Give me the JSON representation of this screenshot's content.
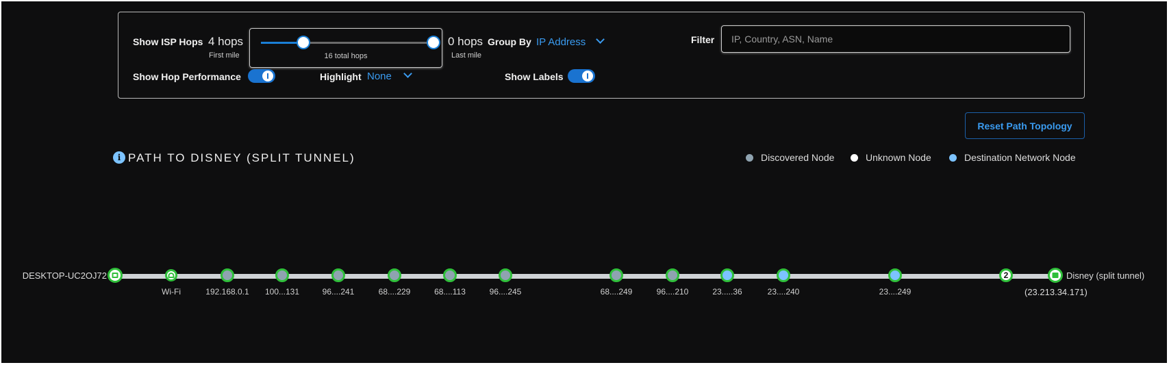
{
  "controls": {
    "show_isp_hops_label": "Show ISP Hops",
    "first_mile_hops": "4 hops",
    "first_mile_label": "First mile",
    "total_hops": "16 total hops",
    "last_mile_hops": "0 hops",
    "last_mile_label": "Last mile",
    "slider": {
      "min": 0,
      "max": 16,
      "first_mile": 4,
      "last_mile": 0
    },
    "group_by_label": "Group By",
    "group_by_value": "IP Address",
    "filter_label": "Filter",
    "filter_placeholder": "IP, Country, ASN, Name",
    "filter_value": "",
    "show_hop_performance_label": "Show Hop Performance",
    "show_hop_performance": true,
    "highlight_label": "Highlight",
    "highlight_value": "None",
    "show_labels_label": "Show Labels",
    "show_labels": true
  },
  "reset_button": "Reset Path Topology",
  "title": "PATH TO DISNEY (SPLIT TUNNEL)",
  "legend": [
    {
      "label": "Discovered Node",
      "color": "#8fa3b0"
    },
    {
      "label": "Unknown Node",
      "color": "#ffffff"
    },
    {
      "label": "Destination Network Node",
      "color": "#7cc3ff"
    }
  ],
  "path": {
    "source": "DESKTOP-UC2OJ72",
    "destination": "Disney (split tunnel)",
    "destination_ip": "(23.213.34.171)",
    "nodes": [
      {
        "type": "source",
        "label": ""
      },
      {
        "type": "wifi",
        "label": "Wi-Fi"
      },
      {
        "type": "discovered",
        "label": "192.168.0.1"
      },
      {
        "type": "discovered",
        "label": "100...131"
      },
      {
        "type": "discovered",
        "label": "96....241"
      },
      {
        "type": "discovered",
        "label": "68....229"
      },
      {
        "type": "discovered",
        "label": "68....113"
      },
      {
        "type": "discovered",
        "label": "96....245"
      },
      {
        "type": "discovered",
        "label": "68....249"
      },
      {
        "type": "discovered",
        "label": "96....210"
      },
      {
        "type": "destination-network",
        "label": "23.....36"
      },
      {
        "type": "destination-network",
        "label": "23....240"
      },
      {
        "type": "destination-network",
        "label": "23....249"
      },
      {
        "type": "unknown-group",
        "label": "",
        "count": "2"
      },
      {
        "type": "destination",
        "label": ""
      }
    ]
  }
}
